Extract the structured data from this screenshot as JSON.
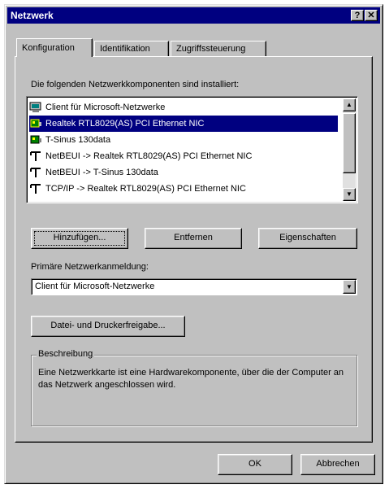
{
  "window": {
    "title": "Netzwerk",
    "help_label": "?",
    "close_label": "✕"
  },
  "tabs": [
    {
      "label": "Konfiguration",
      "active": true
    },
    {
      "label": "Identifikation",
      "active": false
    },
    {
      "label": "Zugriffssteuerung",
      "active": false
    }
  ],
  "components": {
    "label": "Die folgenden Netzwerkkomponenten sind installiert:",
    "items": [
      {
        "label": "Client für Microsoft-Netzwerke",
        "icon": "client-icon",
        "selected": false
      },
      {
        "label": "Realtek RTL8029(AS) PCI Ethernet NIC",
        "icon": "network-card-icon",
        "selected": true
      },
      {
        "label": "T-Sinus 130data",
        "icon": "network-card-icon",
        "selected": false
      },
      {
        "label": "NetBEUI -> Realtek RTL8029(AS) PCI Ethernet NIC",
        "icon": "protocol-icon",
        "selected": false
      },
      {
        "label": "NetBEUI -> T-Sinus 130data",
        "icon": "protocol-icon",
        "selected": false
      },
      {
        "label": "TCP/IP -> Realtek RTL8029(AS) PCI Ethernet NIC",
        "icon": "protocol-icon",
        "selected": false
      }
    ]
  },
  "actions": {
    "add_label": "Hinzufügen...",
    "remove_label": "Entfernen",
    "properties_label": "Eigenschaften"
  },
  "primary_logon": {
    "label": "Primäre Netzwerkanmeldung:",
    "value": "Client für Microsoft-Netzwerke"
  },
  "sharing_button_label": "Datei- und Druckerfreigabe...",
  "description": {
    "title": "Beschreibung",
    "text": "Eine Netzwerkkarte ist eine Hardwarekomponente, über die der Computer an das Netzwerk angeschlossen wird."
  },
  "footer": {
    "ok_label": "OK",
    "cancel_label": "Abbrechen"
  },
  "colors": {
    "titlebar": "#000080",
    "face": "#c0c0c0",
    "selection": "#000080"
  }
}
